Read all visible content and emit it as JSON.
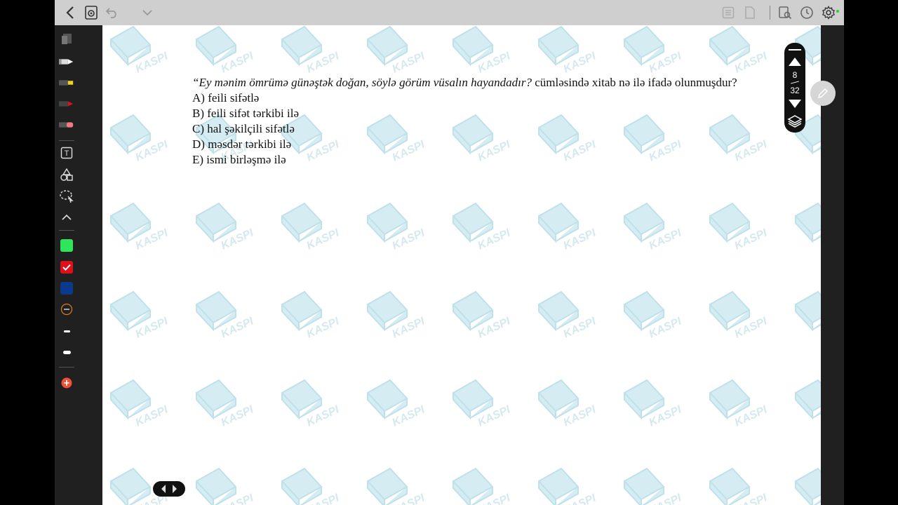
{
  "app": {
    "topbar_left_icons": [
      "back-chevron-icon",
      "document-settings-icon",
      "undo-icon",
      "dropdown-chevron-icon"
    ],
    "topbar_right_icons": [
      "outline-icon",
      "page-icon",
      "search-document-icon",
      "history-clock-icon",
      "settings-gear-icon"
    ],
    "status_dot_color": "#2ecc40"
  },
  "sidebar": {
    "tools": [
      "eraser-tool-icon",
      "pen-tool-icon",
      "highlighter-yellow-icon",
      "pen-red-icon",
      "eraser-pink-icon",
      "text-tool-icon",
      "shapes-tool-icon",
      "lasso-select-icon",
      "collapse-chevron-icon"
    ],
    "colors": [
      {
        "name": "green",
        "hex": "#2ee65c",
        "selected": false
      },
      {
        "name": "red",
        "hex": "#e0101a",
        "selected": true
      },
      {
        "name": "navy",
        "hex": "#0a3a8c",
        "selected": false
      }
    ],
    "stroke_sizes": [
      "thin",
      "medium",
      "thick"
    ]
  },
  "document": {
    "watermark_text": "KASPI",
    "question": {
      "stem_italic": "“Ey mənim ömrümə günəştək doğan, söylə görüm vüsalın hayandadır?",
      "stem_rest": " cümləsində xitab nə ilə ifadə olunmuşdur?",
      "options": [
        "A) feili sifətlə",
        "B) feili sifət tərkibi ilə",
        "C) hal şəkilçili sifətlə",
        "D) məsdər tərkibi ilə",
        "E) ismi birləşmə ilə"
      ]
    }
  },
  "pager": {
    "current_page": "8",
    "total_pages": "32"
  }
}
